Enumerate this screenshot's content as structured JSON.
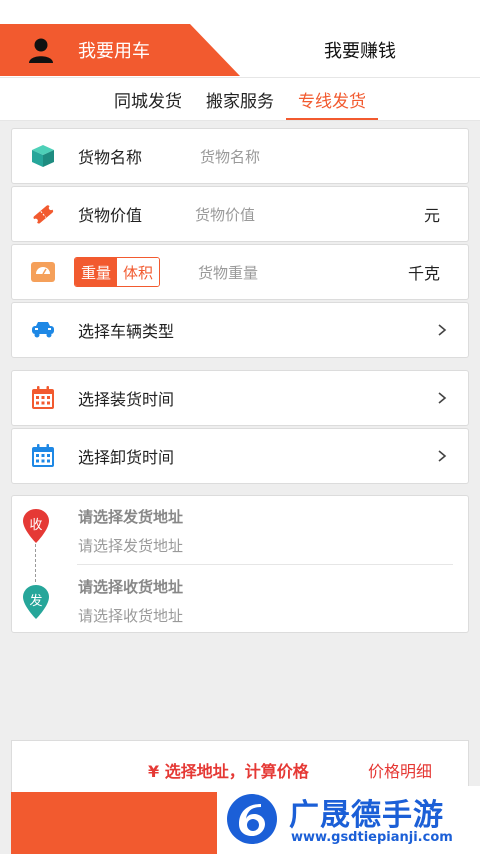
{
  "header": {
    "role_active": "我要用车",
    "role_other": "我要赚钱"
  },
  "tabs": [
    {
      "label": "同城发货"
    },
    {
      "label": "搬家服务"
    },
    {
      "label": "专线发货"
    }
  ],
  "form": {
    "goods_name": {
      "label": "货物名称",
      "placeholder": "货物名称"
    },
    "goods_value": {
      "label": "货物价值",
      "placeholder": "货物价值",
      "unit": "元"
    },
    "goods_weight": {
      "toggle_on": "重量",
      "toggle_off": "体积",
      "placeholder": "货物重量",
      "unit": "千克"
    },
    "vehicle": {
      "label": "选择车辆类型"
    },
    "load_time": {
      "label": "选择装货时间"
    },
    "unload_time": {
      "label": "选择卸货时间"
    }
  },
  "address": {
    "pin_receive": "收",
    "pin_send": "发",
    "from_title": "请选择发货地址",
    "from_sub": "请选择发货地址",
    "to_title": "请选择收货地址",
    "to_sub": "请选择收货地址"
  },
  "footer": {
    "price_text": "¥ 选择地址，计算价格",
    "detail_text": "价格明细"
  },
  "watermark": {
    "title": "广晟德手游",
    "url": "www.gsdtiepianji.com"
  },
  "colors": {
    "accent": "#f25a2f",
    "price_red": "#e53935",
    "teal": "#26a69a",
    "blue": "#1e88e5",
    "watermark_blue": "#1b5fd7"
  }
}
